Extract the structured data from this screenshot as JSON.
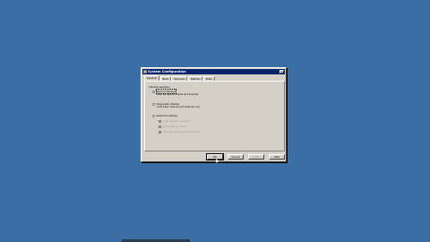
{
  "window": {
    "title": "System Configuration",
    "minimize_glyph": "_",
    "maximize_glyph": "□",
    "close_glyph": "×"
  },
  "tabs": [
    {
      "label": "General",
      "active": true
    },
    {
      "label": "Boot",
      "active": false
    },
    {
      "label": "Services",
      "active": false
    },
    {
      "label": "Startup",
      "active": false
    },
    {
      "label": "Tools",
      "active": false
    }
  ],
  "general": {
    "section_label": "Startup selection",
    "options": [
      {
        "label": "Normal startup",
        "desc": "Load all device drivers and services",
        "selected": true
      },
      {
        "label": "Diagnostic startup",
        "desc": "Load basic devices and services only",
        "selected": false
      },
      {
        "label": "Selective startup",
        "desc": "",
        "selected": false
      }
    ],
    "sub_options": [
      {
        "label": "Load system services",
        "checked": true
      },
      {
        "label": "Load startup items",
        "checked": true
      },
      {
        "label": "Use original boot configuration",
        "checked": true
      }
    ]
  },
  "buttons": {
    "ok": "OK",
    "cancel": "Cancel",
    "apply": "Apply",
    "help": "Help"
  },
  "colors": {
    "desktop": "#3a6ea5",
    "titlebar": "#0a246a",
    "dialog": "#d4d0c8"
  }
}
